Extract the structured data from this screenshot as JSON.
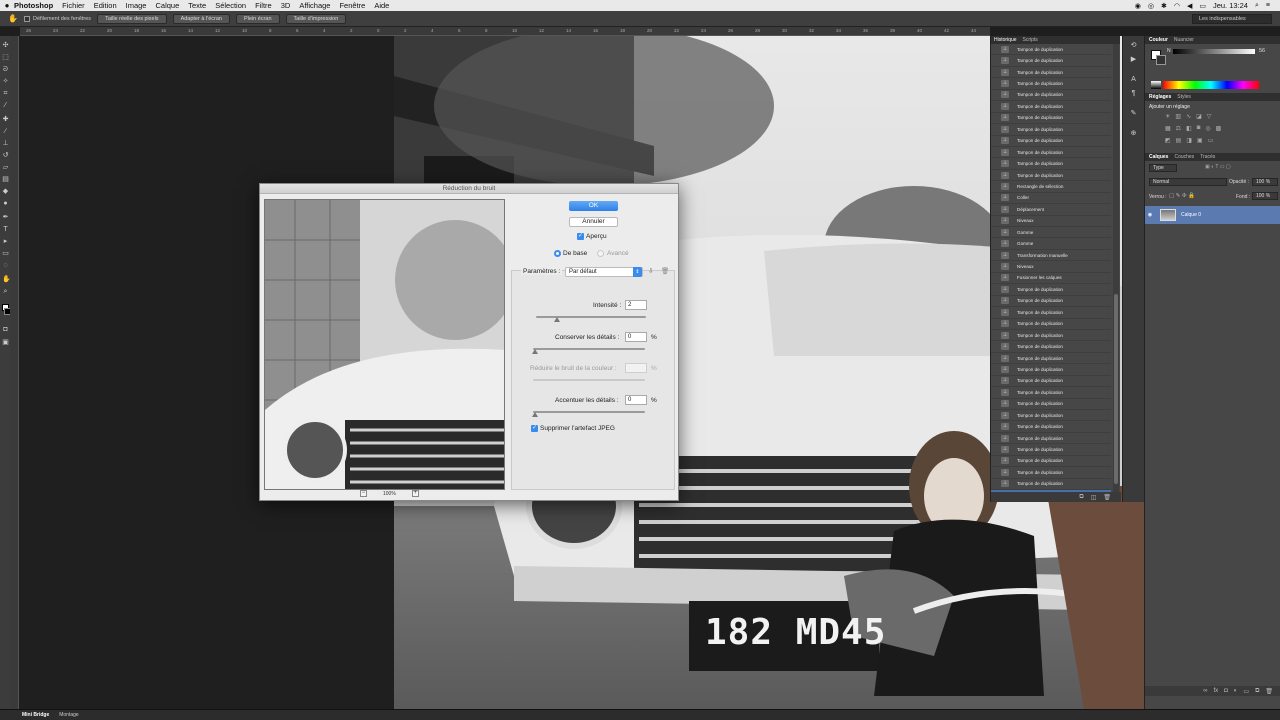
{
  "menubar": {
    "apple": "",
    "items": [
      "Photoshop",
      "Fichier",
      "Edition",
      "Image",
      "Calque",
      "Texte",
      "Sélection",
      "Filtre",
      "3D",
      "Affichage",
      "Fenêtre",
      "Aide"
    ],
    "clock": "Jeu. 13:24"
  },
  "options": {
    "scroll_all_windows": "Défilement des fenêtres",
    "actual_pixels": "Taille réelle des pixels",
    "fit_screen": "Adapter à l'écran",
    "fill_screen": "Plein écran",
    "print_size": "Taille d'impression",
    "workspace": "Les indispensables"
  },
  "ruler_ticks": [
    "26",
    "24",
    "22",
    "20",
    "18",
    "16",
    "14",
    "12",
    "10",
    "8",
    "6",
    "4",
    "2",
    "0",
    "2",
    "4",
    "6",
    "8",
    "10",
    "12",
    "14",
    "16",
    "18",
    "20",
    "22",
    "24",
    "26",
    "28",
    "30",
    "32",
    "34",
    "36",
    "38",
    "40",
    "42",
    "44"
  ],
  "photo": {
    "plate": "182 MD45"
  },
  "dialog": {
    "title": "Réduction du bruit",
    "ok": "OK",
    "cancel": "Annuler",
    "preview_label": "Aperçu",
    "mode_basic": "De base",
    "mode_advanced": "Avancé",
    "params_label": "Paramètres :",
    "params_value": "Par défaut",
    "strength_label": "Intensité :",
    "strength_value": "2",
    "detail_label": "Conserver les détails :",
    "detail_value": "0",
    "color_noise_label": "Réduire le bruit de la couleur :",
    "color_noise_value": "",
    "sharpen_label": "Accentuer les détails :",
    "sharpen_value": "0",
    "pct": "%",
    "jpeg_label": "Supprimer l'artefact JPEG",
    "zoom": "100%",
    "zoom_out": "−",
    "zoom_in": "+"
  },
  "history": {
    "tabs": [
      "Historique",
      "Scripts"
    ],
    "items": [
      "Tampon de duplication",
      "Tampon de duplication",
      "Tampon de duplication",
      "Tampon de duplication",
      "Tampon de duplication",
      "Tampon de duplication",
      "Tampon de duplication",
      "Tampon de duplication",
      "Tampon de duplication",
      "Tampon de duplication",
      "Tampon de duplication",
      "Tampon de duplication",
      "Rectangle de sélection",
      "Coller",
      "Déplacement",
      "Niveaux",
      "Gomme",
      "Gomme",
      "Transformation manuelle",
      "Niveaux",
      "Fusionner les calques",
      "Tampon de duplication",
      "Tampon de duplication",
      "Tampon de duplication",
      "Tampon de duplication",
      "Tampon de duplication",
      "Tampon de duplication",
      "Tampon de duplication",
      "Tampon de duplication",
      "Tampon de duplication",
      "Tampon de duplication",
      "Tampon de duplication",
      "Tampon de duplication",
      "Tampon de duplication",
      "Tampon de duplication",
      "Tampon de duplication",
      "Tampon de duplication",
      "Tampon de duplication",
      "Tampon de duplication",
      "Tampon de duplication"
    ]
  },
  "color_panel": {
    "tabs": [
      "Couleur",
      "Nuancier"
    ],
    "channel": "N",
    "value": "56"
  },
  "adjustments": {
    "tabs": [
      "Réglages",
      "Styles"
    ],
    "title": "Ajouter un réglage"
  },
  "layers": {
    "tabs": [
      "Calques",
      "Couches",
      "Tracés"
    ],
    "filter": "Type",
    "blend": "Normal",
    "opacity_label": "Opacité :",
    "opacity": "100 %",
    "lock_label": "Verrou :",
    "fill_label": "Fond :",
    "fill": "100 %",
    "layer_name": "Calque 0"
  },
  "bottom": {
    "mini_bridge": "Mini Bridge",
    "montage": "Montage"
  }
}
